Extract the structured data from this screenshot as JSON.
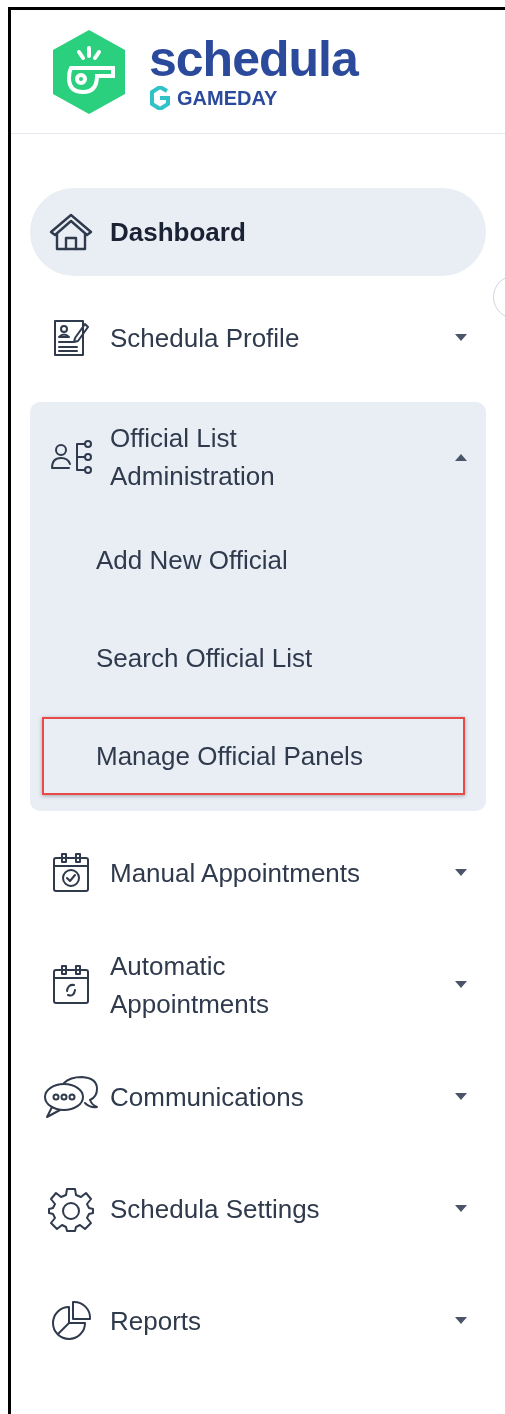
{
  "logo": {
    "name": "schedula",
    "brand": "GAMEDAY"
  },
  "nav": [
    {
      "kind": "link",
      "label": "Dashboard",
      "selected": true
    },
    {
      "kind": "group",
      "label": "Schedula Profile",
      "expanded": false
    },
    {
      "kind": "group",
      "label": "Official List Administration",
      "expanded": true,
      "children": [
        {
          "label": "Add New Official",
          "highlighted": false
        },
        {
          "label": "Search Official List",
          "highlighted": false
        },
        {
          "label": "Manage Official Panels",
          "highlighted": true
        }
      ]
    },
    {
      "kind": "group",
      "label": "Manual Appointments",
      "expanded": false
    },
    {
      "kind": "group",
      "label": "Automatic Appointments",
      "expanded": false
    },
    {
      "kind": "group",
      "label": "Communications",
      "expanded": false
    },
    {
      "kind": "group",
      "label": "Schedula Settings",
      "expanded": false
    },
    {
      "kind": "group",
      "label": "Reports",
      "expanded": false
    }
  ]
}
